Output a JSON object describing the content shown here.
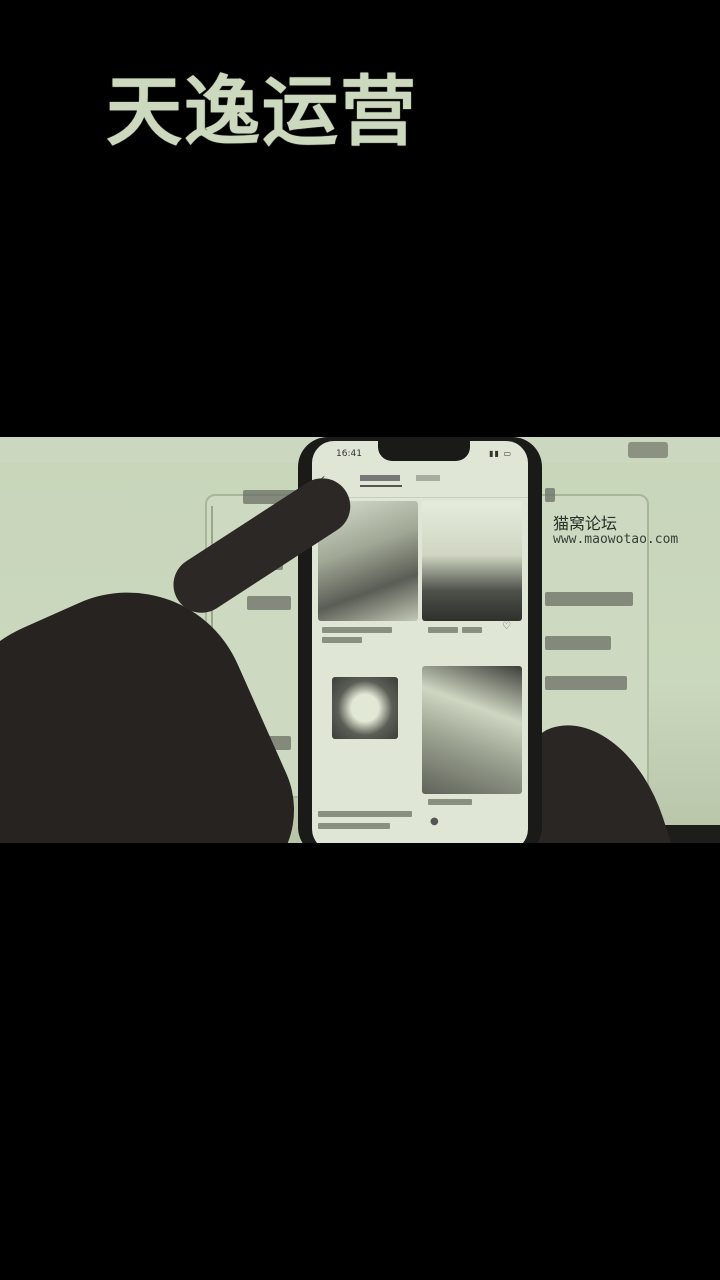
{
  "title": "天逸运营",
  "video": {
    "watermark_cn": "猫窝论坛",
    "watermark_url": "www.maowotao.com",
    "phone_status_time": "16:41"
  }
}
